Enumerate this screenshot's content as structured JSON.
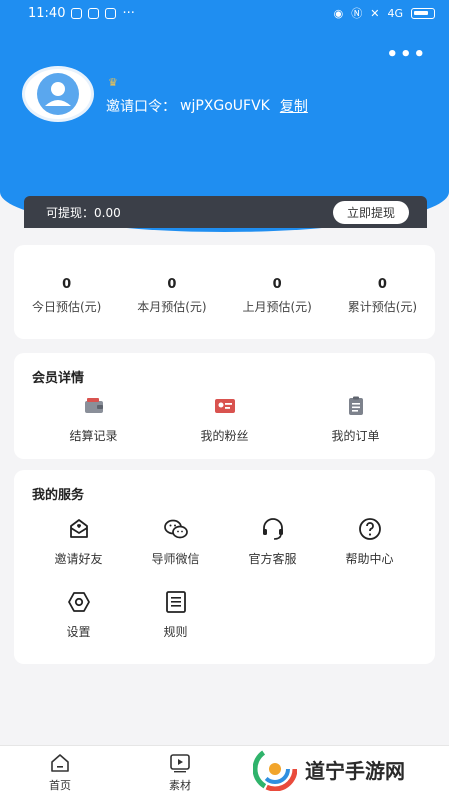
{
  "status_bar": {
    "time": "11:40",
    "dots": "···",
    "network": "4G"
  },
  "header": {
    "more_label": "•••",
    "invite_label": "邀请口令：",
    "invite_code": "wjPXGoUFVK",
    "copy_label": "复制",
    "crown": "♛"
  },
  "withdraw": {
    "label": "可提现：0.00",
    "button": "立即提现"
  },
  "stats": [
    {
      "value": "0",
      "label": "今日预估(元)"
    },
    {
      "value": "0",
      "label": "本月预估(元)"
    },
    {
      "value": "0",
      "label": "上月预估(元)"
    },
    {
      "value": "0",
      "label": "累计预估(元)"
    }
  ],
  "member": {
    "title": "会员详情",
    "items": [
      {
        "label": "结算记录",
        "icon": "wallet-icon"
      },
      {
        "label": "我的粉丝",
        "icon": "id-card-icon"
      },
      {
        "label": "我的订单",
        "icon": "clipboard-icon"
      }
    ]
  },
  "services": {
    "title": "我的服务",
    "items": [
      {
        "label": "邀请好友",
        "icon": "invite-mail-icon"
      },
      {
        "label": "导师微信",
        "icon": "wechat-icon"
      },
      {
        "label": "官方客服",
        "icon": "headset-icon"
      },
      {
        "label": "帮助中心",
        "icon": "help-icon"
      },
      {
        "label": "设置",
        "icon": "settings-icon"
      },
      {
        "label": "规则",
        "icon": "rules-list-icon"
      }
    ]
  },
  "tabbar": [
    {
      "label": "首页",
      "icon": "home-icon"
    },
    {
      "label": "素材",
      "icon": "media-play-icon"
    }
  ],
  "watermark": {
    "text": "道宁手游网"
  },
  "colors": {
    "primary": "#1f8ef1",
    "dark_bar": "#3b3f48",
    "accent_red": "#d9534f",
    "crown": "#f4c44c"
  }
}
